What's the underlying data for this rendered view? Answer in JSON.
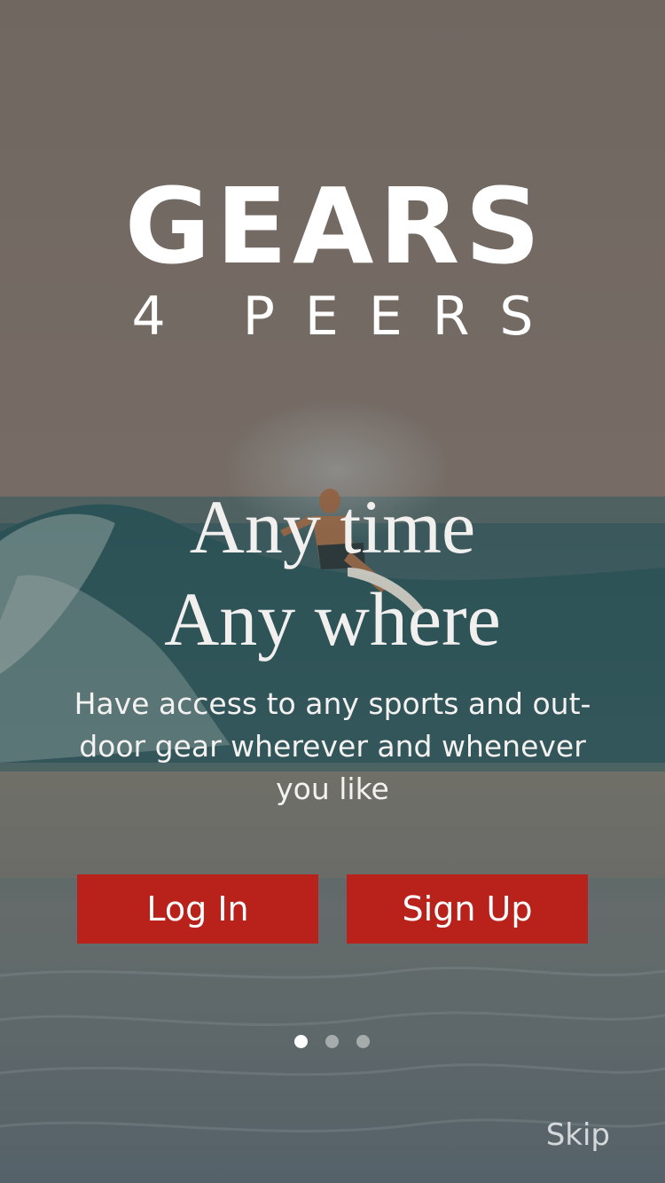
{
  "brand": {
    "title": "GEARS",
    "subtitle": "4 PEERS"
  },
  "hero": {
    "headline_line1": "Any time",
    "headline_line2": "Any where",
    "tagline": "Have access to any sports and out-door gear wherever and whenever you like"
  },
  "actions": {
    "login_label": "Log In",
    "signup_label": "Sign Up",
    "skip_label": "Skip"
  },
  "pager": {
    "count": 3,
    "active_index": 0
  },
  "colors": {
    "button": "#b8221a",
    "overlay": "#7d736d",
    "text": "#ffffff"
  }
}
